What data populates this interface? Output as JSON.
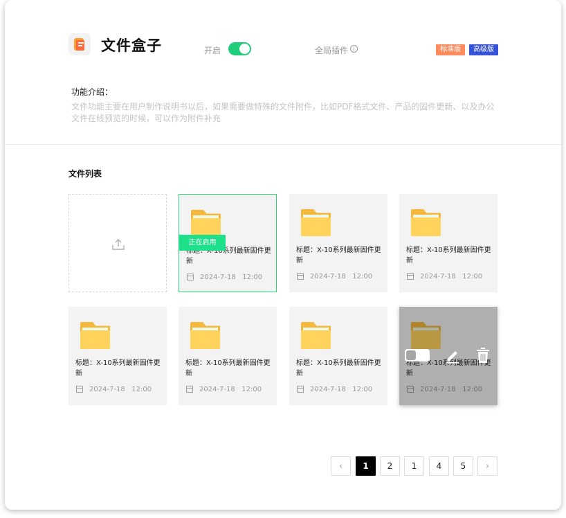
{
  "header": {
    "app_title": "文件盒子",
    "toggle_label": "开启",
    "toggle_on": true,
    "global_plugin_label": "全局插件",
    "badges": [
      "标准版",
      "高级版"
    ]
  },
  "intro": {
    "title": "功能介绍：",
    "text": "文件功能主要在用户制作说明书以后，如果需要做特殊的文件附件，比如PDF格式文件、产品的固件更新、以及办公文件在线预览的时候，可以作为附件补充"
  },
  "files": {
    "section_title": "文件列表",
    "active_tag": "正在启用",
    "items": [
      {
        "title": "标题：X-10系列最新固件更新",
        "date": "2024-7-18   12:00"
      },
      {
        "title": "标题：X-10系列最新固件更新",
        "date": "2024-7-18   12:00"
      },
      {
        "title": "标题：X-10系列最新固件更新",
        "date": "2024-7-18   12:00"
      },
      {
        "title": "标题：X-10系列最新固件更新",
        "date": "2024-7-18   12:00"
      },
      {
        "title": "标题：X-10系列最新固件更新",
        "date": "2024-7-18   12:00"
      },
      {
        "title": "标题：X-10系列最新固件更新",
        "date": "2024-7-18   12:00"
      },
      {
        "title": "标题：X-10系列最新固件更新",
        "date": "2024-7-18   12:00"
      }
    ]
  },
  "pagination": {
    "prev": "‹",
    "next": "›",
    "pages": [
      "1",
      "2",
      "1",
      "4",
      "5"
    ],
    "current_index": 0
  },
  "colors": {
    "accent_green": "#1fcd7a",
    "badge_standard": "#ff8a5b",
    "badge_pro": "#3552d8"
  }
}
